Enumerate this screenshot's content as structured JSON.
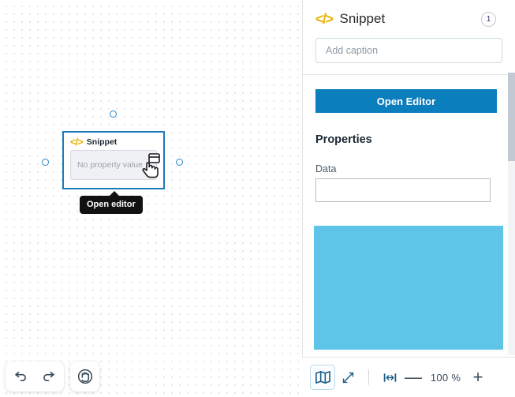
{
  "canvas": {
    "widget": {
      "icon": "code-snippet-icon",
      "title": "Snippet",
      "placeholder": "No property value",
      "cursor_icon": "pointing-hand-cursor-icon",
      "tooltip": "Open editor"
    },
    "toolbar": {
      "undo_icon": "undo-arrow-icon",
      "redo_icon": "redo-arrow-icon",
      "pan_icon": "hand-pan-icon"
    }
  },
  "panel": {
    "icon": "code-snippet-icon",
    "title": "Snippet",
    "badge": "1",
    "caption_placeholder": "Add caption",
    "open_editor_label": "Open Editor",
    "properties_title": "Properties",
    "fields": [
      {
        "label": "Data",
        "value": ""
      }
    ],
    "bottom_toolbar": {
      "map_icon": "book-map-icon",
      "expand_icon": "expand-diagonal-icon",
      "fit_width_icon": "fit-width-icon",
      "zoom_out_label": "—",
      "zoom_level": "100 %",
      "zoom_in_label": "+"
    }
  },
  "colors": {
    "accent_blue": "#0b7ebd",
    "selection_blue": "#1a7bba",
    "overlay_blue": "#5ec5e8",
    "code_icon_yellow": "#eab308"
  }
}
